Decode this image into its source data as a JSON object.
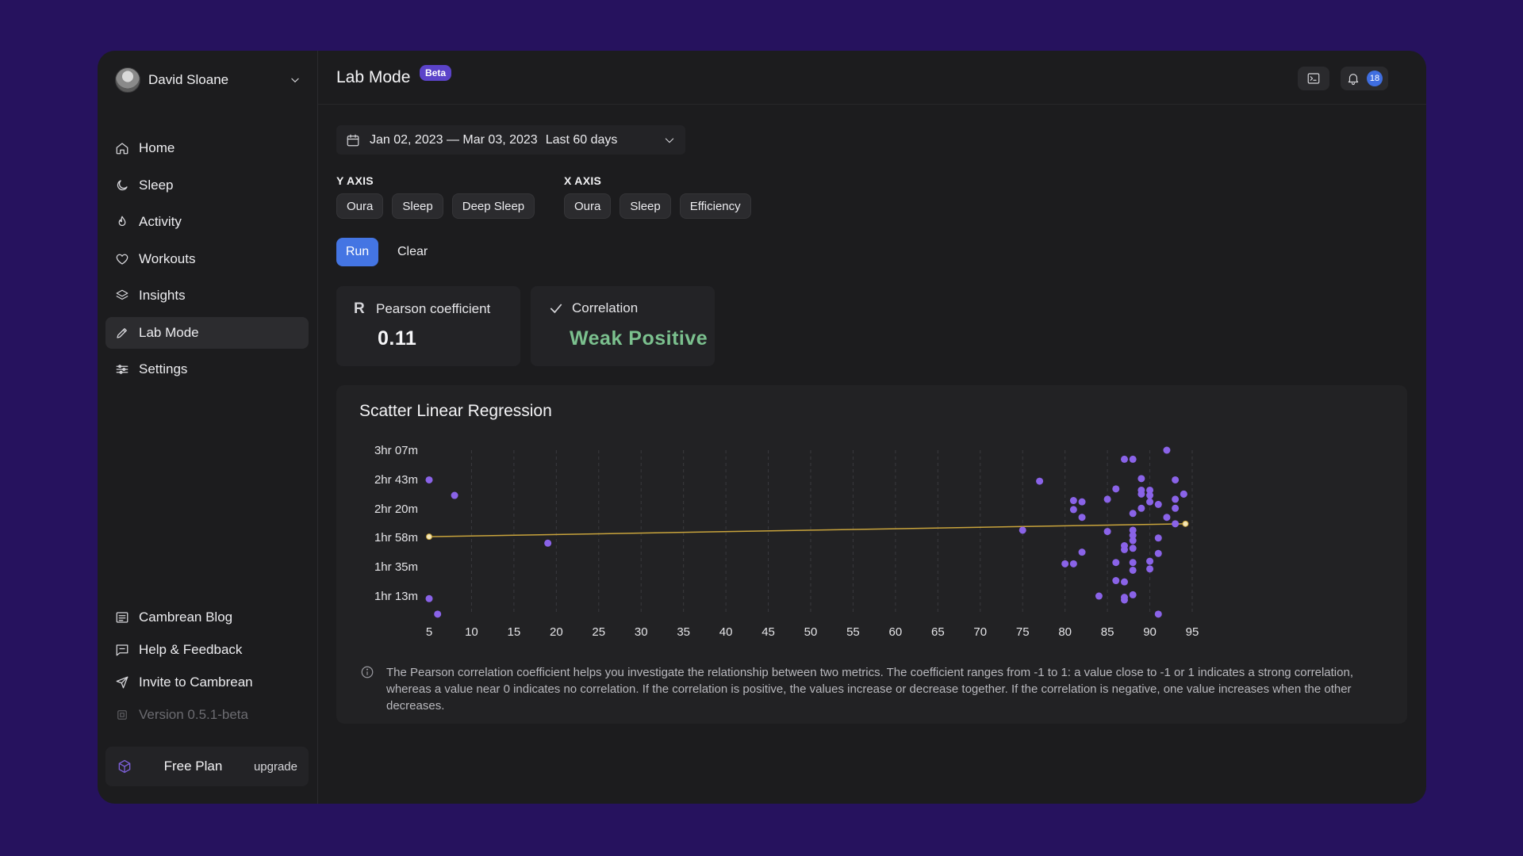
{
  "user": {
    "name": "David Sloane"
  },
  "nav": [
    {
      "label": "Home",
      "icon": "home-icon"
    },
    {
      "label": "Sleep",
      "icon": "moon-icon"
    },
    {
      "label": "Activity",
      "icon": "flame-icon"
    },
    {
      "label": "Workouts",
      "icon": "heart-icon"
    },
    {
      "label": "Insights",
      "icon": "layers-icon"
    },
    {
      "label": "Lab Mode",
      "icon": "pencil-icon",
      "active": true
    },
    {
      "label": "Settings",
      "icon": "sliders-icon"
    }
  ],
  "bottom_links": [
    {
      "label": "Cambrean Blog",
      "icon": "newspaper-icon"
    },
    {
      "label": "Help & Feedback",
      "icon": "message-icon"
    },
    {
      "label": "Invite to Cambrean",
      "icon": "send-icon"
    },
    {
      "label": "Version 0.5.1-beta",
      "icon": "chip-icon"
    }
  ],
  "plan": {
    "name": "Free Plan",
    "upgrade": "upgrade"
  },
  "header": {
    "title": "Lab Mode",
    "badge": "Beta",
    "notification_count": "18"
  },
  "date_picker": {
    "range": "Jan 02, 2023 — Mar 03, 2023",
    "preset": "Last 60 days"
  },
  "y_axis": {
    "label": "Y AXIS",
    "chips": [
      "Oura",
      "Sleep",
      "Deep Sleep"
    ]
  },
  "x_axis": {
    "label": "X AXIS",
    "chips": [
      "Oura",
      "Sleep",
      "Efficiency"
    ]
  },
  "actions": {
    "run": "Run",
    "clear": "Clear"
  },
  "stats": {
    "pearson": {
      "icon_text": "R",
      "label": "Pearson coefficient",
      "value": "0.11"
    },
    "correlation": {
      "label": "Correlation",
      "value": "Weak Positive"
    }
  },
  "colors": {
    "accent": "#4475e3",
    "point": "#8a63e8",
    "regression": "#c9a43c",
    "positive": "#7bc08e",
    "background": "#26125e"
  },
  "chart_data": {
    "type": "scatter",
    "title": "Scatter Linear Regression",
    "x_ticks": [
      "5",
      "10",
      "15",
      "20",
      "25",
      "30",
      "35",
      "40",
      "45",
      "50",
      "55",
      "60",
      "65",
      "70",
      "75",
      "80",
      "85",
      "90",
      "95"
    ],
    "y_ticks": [
      "3hr 07m",
      "2hr 43m",
      "2hr 20m",
      "1hr 58m",
      "1hr 35m",
      "1hr 13m"
    ],
    "xlim": [
      5,
      95
    ],
    "ylim_minutes": [
      55,
      187
    ],
    "grid": "vertical dashed",
    "regression": {
      "x": [
        5,
        94.2
      ],
      "y_minutes": [
        120,
        130
      ]
    },
    "points": [
      [
        5,
        164
      ],
      [
        5,
        72
      ],
      [
        6,
        60
      ],
      [
        8,
        152
      ],
      [
        19,
        115
      ],
      [
        75,
        125
      ],
      [
        77,
        163
      ],
      [
        80,
        99
      ],
      [
        81,
        148
      ],
      [
        81,
        141
      ],
      [
        81,
        99
      ],
      [
        82,
        147
      ],
      [
        82,
        135
      ],
      [
        82,
        108
      ],
      [
        84,
        74
      ],
      [
        85,
        149
      ],
      [
        85,
        124
      ],
      [
        86,
        157
      ],
      [
        86,
        100
      ],
      [
        86,
        86
      ],
      [
        87,
        180
      ],
      [
        87,
        113
      ],
      [
        87,
        110
      ],
      [
        87,
        85
      ],
      [
        87,
        73
      ],
      [
        87,
        71
      ],
      [
        88,
        180
      ],
      [
        88,
        138
      ],
      [
        88,
        125
      ],
      [
        88,
        121
      ],
      [
        88,
        117
      ],
      [
        88,
        111
      ],
      [
        88,
        100
      ],
      [
        88,
        94
      ],
      [
        88,
        75
      ],
      [
        89,
        165
      ],
      [
        89,
        156
      ],
      [
        89,
        153
      ],
      [
        89,
        142
      ],
      [
        90,
        156
      ],
      [
        90,
        152
      ],
      [
        90,
        147
      ],
      [
        90,
        101
      ],
      [
        90,
        95
      ],
      [
        91,
        145
      ],
      [
        91,
        119
      ],
      [
        91,
        107
      ],
      [
        91,
        60
      ],
      [
        92,
        187
      ],
      [
        92,
        135
      ],
      [
        93,
        164
      ],
      [
        93,
        149
      ],
      [
        93,
        142
      ],
      [
        93,
        130
      ],
      [
        94,
        153
      ],
      [
        94,
        153
      ]
    ]
  },
  "info_text": "The Pearson correlation coefficient helps you investigate the relationship between two metrics. The coefficient ranges from -1 to 1: a value close to -1 or 1 indicates a strong correlation, whereas a value near 0 indicates no correlation. If the correlation is positive, the values increase or decrease together. If the correlation is negative, one value increases when the other decreases."
}
